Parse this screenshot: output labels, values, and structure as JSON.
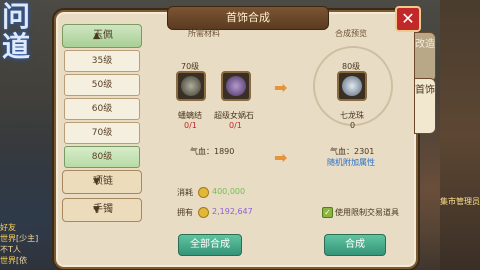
{
  "window": {
    "title": "首饰合成",
    "close_glyph": "✕"
  },
  "categories": {
    "head": "玉佩",
    "levels": [
      "35级",
      "50级",
      "60级",
      "70级",
      "80级"
    ],
    "active_level": "80级",
    "groups": [
      "项链",
      "手镯"
    ]
  },
  "side_tabs": [
    "改造",
    "首饰"
  ],
  "materials": {
    "title": "所需材料",
    "items": [
      {
        "level": "70级",
        "name": "蟠螭结",
        "count": "0/1"
      },
      {
        "level": "",
        "name": "超级女娲石",
        "count": "0/1"
      }
    ],
    "stat": "气血：1890"
  },
  "preview": {
    "title": "合成预览",
    "item": {
      "level": "80级",
      "name": "七龙珠",
      "count": "0"
    },
    "stat": "气血：2301",
    "link": "随机附加属性"
  },
  "cost": {
    "cost_label": "消耗",
    "cost_value": "400,000",
    "own_label": "拥有",
    "own_value": "2,192,647",
    "trade_option": "使用限制交易道具"
  },
  "buttons": {
    "all": "全部合成",
    "compose": "合成"
  },
  "chat": [
    {
      "tag": "好友",
      "text": ""
    },
    {
      "tag": "世界",
      "text": "[少主]"
    },
    {
      "tag": "",
      "text": "不T人"
    },
    {
      "tag": "世界",
      "text": "[依"
    }
  ],
  "scene_label": "集市管理员"
}
